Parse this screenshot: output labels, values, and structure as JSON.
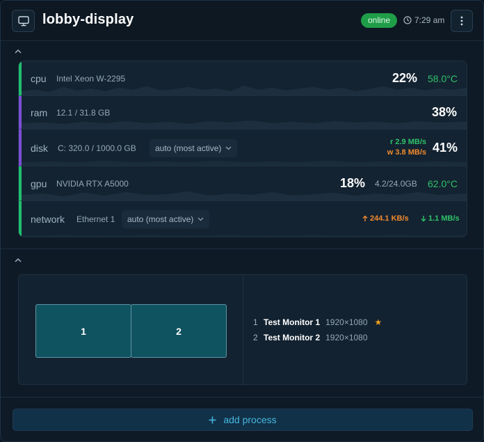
{
  "header": {
    "title": "lobby-display",
    "status": "online",
    "time": "7:29 am"
  },
  "metrics": {
    "cpu": {
      "label": "cpu",
      "model": "Intel Xeon W-2295",
      "usage": "22%",
      "temp": "58.0°C"
    },
    "ram": {
      "label": "ram",
      "detail": "12.1 / 31.8 GB",
      "usage": "38%"
    },
    "disk": {
      "label": "disk",
      "detail": "C:  320.0 / 1000.0 GB",
      "select": "auto (most active)",
      "read": "r  2.9 MB/s",
      "write": "w  3.8 MB/s",
      "usage": "41%"
    },
    "gpu": {
      "label": "gpu",
      "model": "NVIDIA RTX A5000",
      "usage": "18%",
      "mem": "4.2/24.0GB",
      "temp": "62.0°C"
    },
    "network": {
      "label": "network",
      "adapter": "Ethernet 1",
      "select": "auto (most active)",
      "up": "244.1 KB/s",
      "down": "1.1 MB/s"
    }
  },
  "displays": {
    "screens": [
      "1",
      "2"
    ],
    "monitors": [
      {
        "index": "1",
        "name": "Test Monitor 1",
        "resolution": "1920×1080",
        "primary": "★"
      },
      {
        "index": "2",
        "name": "Test Monitor 2",
        "resolution": "1920×1080"
      }
    ]
  },
  "actions": {
    "add_process": "add process"
  },
  "colors": {
    "accent": "#48b6e0",
    "online": "#1f9d48",
    "cpu_bar": "#1fbf6f",
    "ram_bar": "#7b4fd6",
    "disk_bar": "#7b4fd6",
    "gpu_bar": "#1fbf6f",
    "net_bar": "#1fbf6f",
    "temp": "#2ec26a",
    "write": "#f28a2e",
    "star": "#f0a020"
  }
}
